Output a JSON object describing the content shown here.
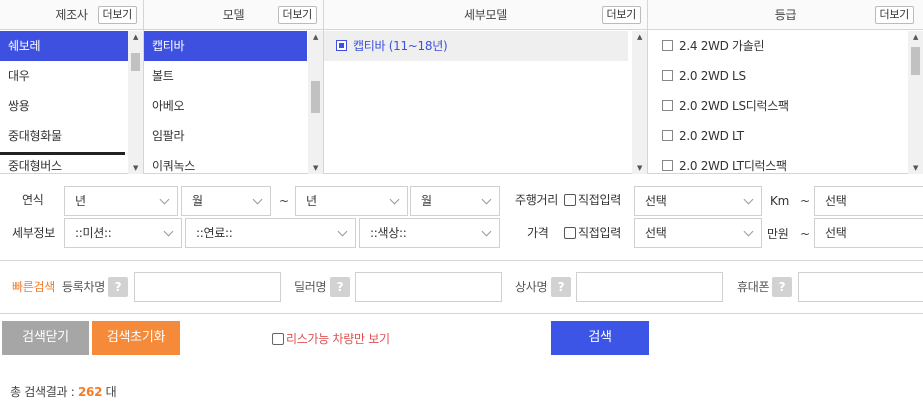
{
  "columns": {
    "maker": {
      "title": "제조사",
      "more": "더보기",
      "items": [
        "쉐보레",
        "대우",
        "쌍용",
        "중대형화물",
        "중대형버스"
      ],
      "selected": 0
    },
    "model": {
      "title": "모델",
      "more": "더보기",
      "items": [
        "캡티바",
        "볼트",
        "아베오",
        "임팔라",
        "이쿼녹스"
      ],
      "selected": 0
    },
    "submodel": {
      "title": "세부모델",
      "more": "더보기",
      "items": [
        "캡티바 (11~18년)"
      ]
    },
    "grade": {
      "title": "등급",
      "more": "더보기",
      "items": [
        "2.4 2WD 가솔린",
        "2.0 2WD LS",
        "2.0 2WD LS디럭스팩",
        "2.0 2WD LT",
        "2.0 2WD LT디럭스팩"
      ]
    }
  },
  "filter": {
    "year_label": "연식",
    "year_from": "년",
    "month_from": "월",
    "tilde": "~",
    "year_to": "년",
    "month_to": "월",
    "mileage_label": "주행거리",
    "direct_input": "직접입력",
    "mileage_from": "선택",
    "mileage_unit": "Km",
    "mileage_to": "선택",
    "detail_label": "세부정보",
    "mission": "::미션::",
    "fuel": "::연료::",
    "color": "::색상::",
    "price_label": "가격",
    "price_from": "선택",
    "price_unit": "만원",
    "price_to": "선택"
  },
  "quick": {
    "title": "빠른검색",
    "reg_no": "등록차명",
    "dealer": "딜러명",
    "company": "상사명",
    "phone": "휴대폰",
    "help": "?"
  },
  "buttons": {
    "close": "검색닫기",
    "reset": "검색초기화",
    "lease_only": "리스가능 차량만 보기",
    "search": "검색"
  },
  "result": {
    "prefix": "총 검색결과 :",
    "count": "262",
    "suffix": "대"
  }
}
